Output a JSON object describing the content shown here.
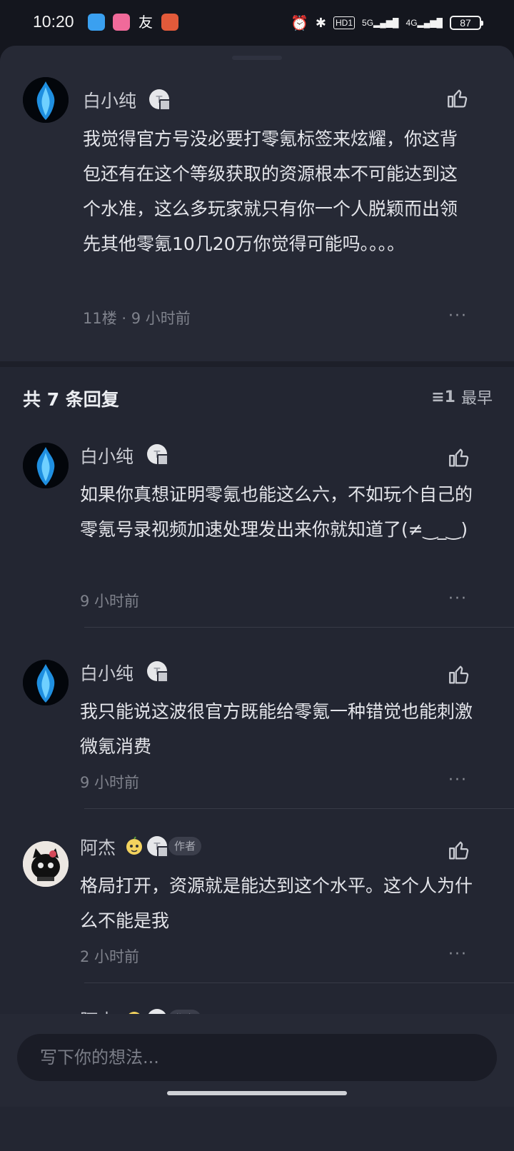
{
  "status_bar": {
    "time": "10:20",
    "battery": "87",
    "hd": "HD1",
    "net1": "5G",
    "net2": "4G"
  },
  "main_comment": {
    "user": "白小纯",
    "badge": "T",
    "text": "我觉得官方号没必要打零氪标签来炫耀，你这背包还有在这个等级获取的资源根本不可能达到这个水准，这么多玩家就只有你一个人脱颖而出领先其他零氪10几20万你觉得可能吗。。。。",
    "meta": "11楼 · 9 小时前",
    "more": "···"
  },
  "replies_header": {
    "count_label": "共 7 条回复",
    "sort_label": "最早"
  },
  "replies": [
    {
      "user": "白小纯",
      "badge": "T",
      "text": "如果你真想证明零氪也能这么六，不如玩个自己的零氪号录视频加速处理发出来你就知道了(≠‿_‿)",
      "time": "9 小时前",
      "more": "···"
    },
    {
      "user": "白小纯",
      "badge": "T",
      "text": "我只能说这波很官方既能给零氪一种错觉也能刺激微氪消费",
      "time": "9 小时前",
      "more": "···"
    },
    {
      "user": "阿杰",
      "badge": "T",
      "author_tag": "作者",
      "text": "格局打开，资源就是能达到这个水平。这个人为什么不能是我",
      "time": "2 小时前",
      "more": "···"
    },
    {
      "user": "阿杰",
      "badge": "T",
      "author_tag": "作者"
    }
  ],
  "input": {
    "placeholder": "写下你的想法..."
  },
  "colors": {
    "sheet_bg": "#232632",
    "text": "#e4e5ea",
    "muted": "#7f828c"
  }
}
